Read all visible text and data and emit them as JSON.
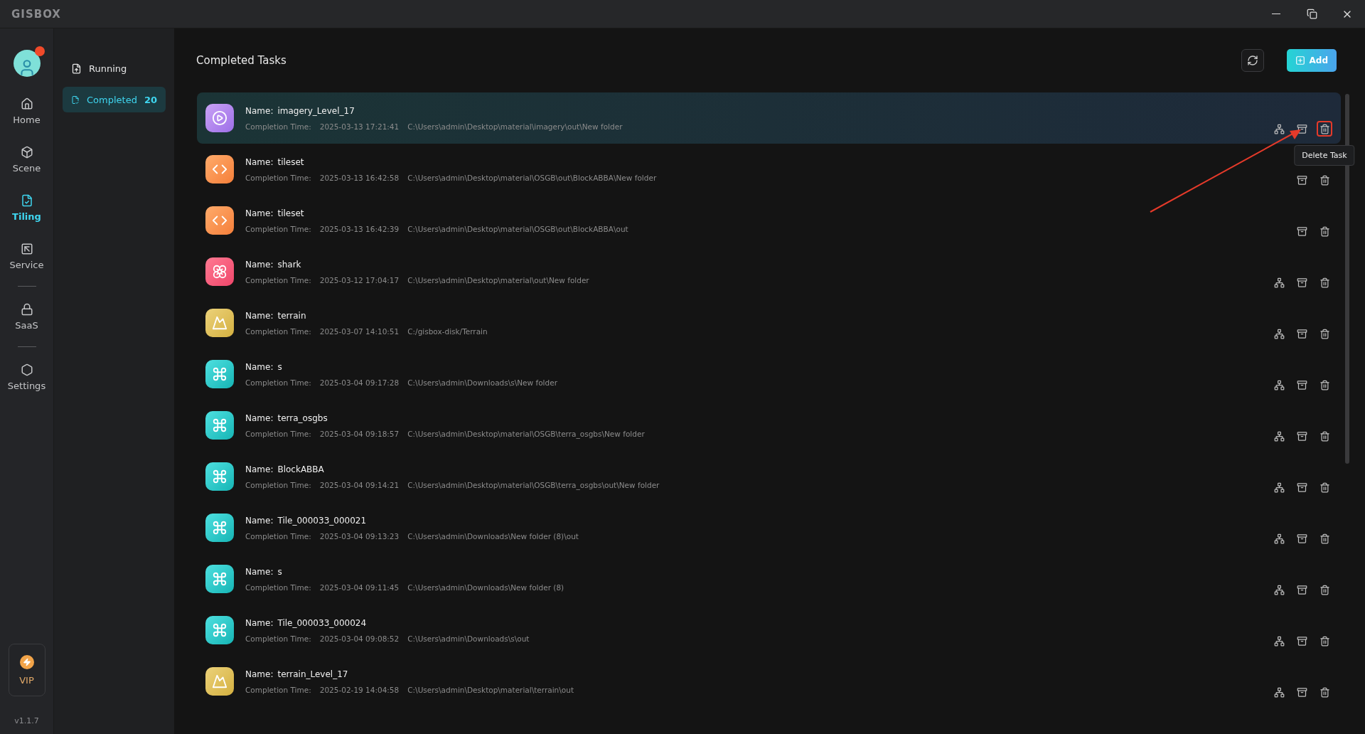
{
  "app": {
    "logo": "GISBOX"
  },
  "rail": {
    "items": [
      {
        "label": "Home",
        "kind": "home",
        "selected": false,
        "divider_before": false
      },
      {
        "label": "Scene",
        "kind": "scene",
        "selected": false,
        "divider_before": false
      },
      {
        "label": "Tiling",
        "kind": "tiling",
        "selected": true,
        "divider_before": false
      },
      {
        "label": "Service",
        "kind": "service",
        "selected": false,
        "divider_before": false
      },
      {
        "label": "SaaS",
        "kind": "saas",
        "selected": false,
        "divider_before": true
      },
      {
        "label": "Settings",
        "kind": "settings",
        "selected": false,
        "divider_before": true
      }
    ],
    "vip": "VIP",
    "version": "v1.1.7"
  },
  "subnav": [
    {
      "label": "Running",
      "kind": "running",
      "selected": false
    },
    {
      "label": "Completed",
      "kind": "completed",
      "selected": true,
      "count": "20"
    }
  ],
  "header": {
    "title": "Completed Tasks",
    "add_button": "Add"
  },
  "tasks": [
    {
      "kind": "imagery",
      "name_label": "Name:",
      "name": "imagery_Level_17",
      "time_label": "Completion Time:",
      "time": "2025-03-13 17:21:41",
      "path": "C:\\Users\\admin\\Desktop\\material\\imagery\\out\\New folder",
      "selected": true,
      "has_structure": true,
      "tooltip": "Delete Task"
    },
    {
      "kind": "tileset",
      "name_label": "Name:",
      "name": "tileset",
      "time_label": "Completion Time:",
      "time": "2025-03-13 16:42:58",
      "path": "C:\\Users\\admin\\Desktop\\material\\OSGB\\out\\BlockABBA\\New folder",
      "selected": false,
      "has_structure": false
    },
    {
      "kind": "tileset",
      "name_label": "Name:",
      "name": "tileset",
      "time_label": "Completion Time:",
      "time": "2025-03-13 16:42:39",
      "path": "C:\\Users\\admin\\Desktop\\material\\OSGB\\out\\BlockABBA\\out",
      "selected": false,
      "has_structure": false
    },
    {
      "kind": "model",
      "name_label": "Name:",
      "name": "shark",
      "time_label": "Completion Time:",
      "time": "2025-03-12 17:04:17",
      "path": "C:\\Users\\admin\\Desktop\\material\\out\\New folder",
      "selected": false,
      "has_structure": true
    },
    {
      "kind": "terrain",
      "name_label": "Name:",
      "name": "terrain",
      "time_label": "Completion Time:",
      "time": "2025-03-07 14:10:51",
      "path": "C:/gisbox-disk/Terrain",
      "selected": false,
      "has_structure": true
    },
    {
      "kind": "osgb",
      "name_label": "Name:",
      "name": "s",
      "time_label": "Completion Time:",
      "time": "2025-03-04 09:17:28",
      "path": "C:\\Users\\admin\\Downloads\\s\\New folder",
      "selected": false,
      "has_structure": true
    },
    {
      "kind": "osgb",
      "name_label": "Name:",
      "name": "terra_osgbs",
      "time_label": "Completion Time:",
      "time": "2025-03-04 09:18:57",
      "path": "C:\\Users\\admin\\Desktop\\material\\OSGB\\terra_osgbs\\New folder",
      "selected": false,
      "has_structure": true
    },
    {
      "kind": "osgb",
      "name_label": "Name:",
      "name": "BlockABBA",
      "time_label": "Completion Time:",
      "time": "2025-03-04 09:14:21",
      "path": "C:\\Users\\admin\\Desktop\\material\\OSGB\\terra_osgbs\\out\\New folder",
      "selected": false,
      "has_structure": true
    },
    {
      "kind": "osgb",
      "name_label": "Name:",
      "name": "Tile_000033_000021",
      "time_label": "Completion Time:",
      "time": "2025-03-04 09:13:23",
      "path": "C:\\Users\\admin\\Downloads\\New folder (8)\\out",
      "selected": false,
      "has_structure": true
    },
    {
      "kind": "osgb",
      "name_label": "Name:",
      "name": "s",
      "time_label": "Completion Time:",
      "time": "2025-03-04 09:11:45",
      "path": "C:\\Users\\admin\\Downloads\\New folder (8)",
      "selected": false,
      "has_structure": true
    },
    {
      "kind": "osgb",
      "name_label": "Name:",
      "name": "Tile_000033_000024",
      "time_label": "Completion Time:",
      "time": "2025-03-04 09:08:52",
      "path": "C:\\Users\\admin\\Downloads\\s\\out",
      "selected": false,
      "has_structure": true
    },
    {
      "kind": "terrain",
      "name_label": "Name:",
      "name": "terrain_Level_17",
      "time_label": "Completion Time:",
      "time": "2025-02-19 14:04:58",
      "path": "C:\\Users\\admin\\Desktop\\material\\terrain\\out",
      "selected": false,
      "has_structure": true
    }
  ]
}
